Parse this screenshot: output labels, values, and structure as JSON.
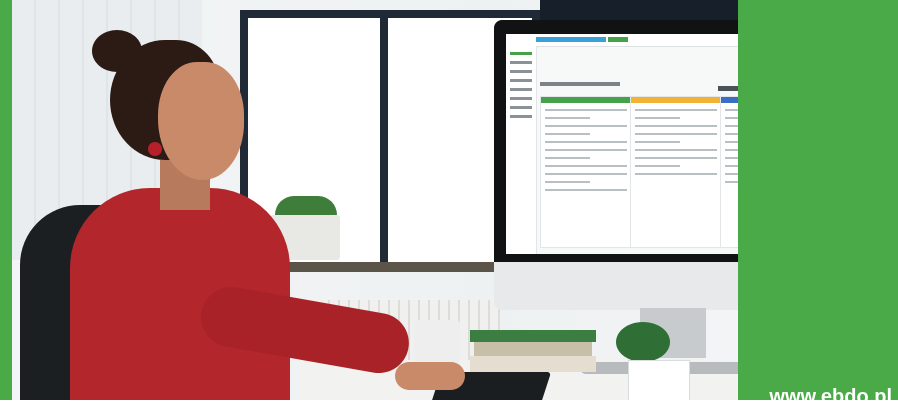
{
  "brand": {
    "url": "www.ebdo.pl",
    "accent_color": "#4aaa47"
  }
}
